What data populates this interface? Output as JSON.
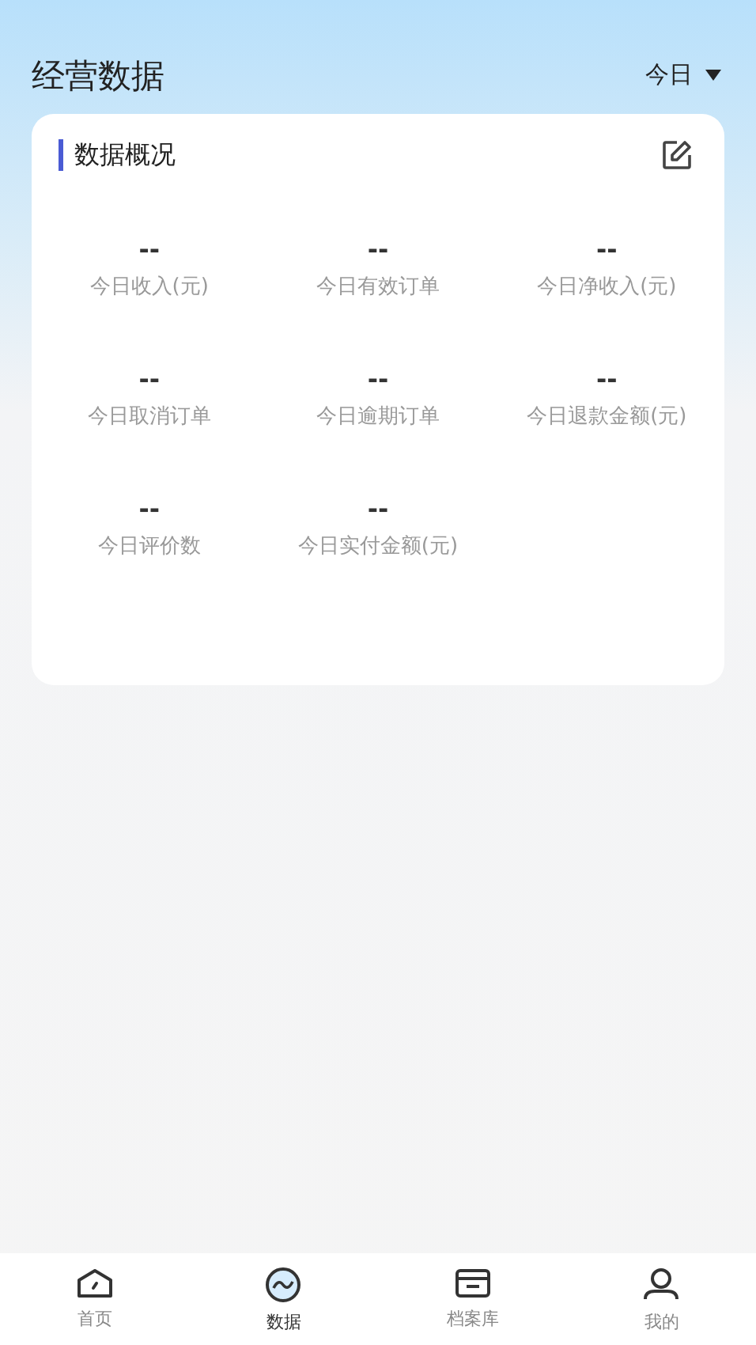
{
  "header": {
    "title": "经营数据",
    "period": "今日"
  },
  "card": {
    "title": "数据概况",
    "metrics": [
      {
        "value": "--",
        "label": "今日收入(元)"
      },
      {
        "value": "--",
        "label": "今日有效订单"
      },
      {
        "value": "--",
        "label": "今日净收入(元)"
      },
      {
        "value": "--",
        "label": "今日取消订单"
      },
      {
        "value": "--",
        "label": "今日逾期订单"
      },
      {
        "value": "--",
        "label": "今日退款金额(元)"
      },
      {
        "value": "--",
        "label": "今日评价数"
      },
      {
        "value": "--",
        "label": "今日实付金额(元)"
      }
    ]
  },
  "tab_bar": [
    {
      "label": "首页",
      "kind": "home",
      "selected": false
    },
    {
      "label": "数据",
      "kind": "data",
      "selected": true
    },
    {
      "label": "档案库",
      "kind": "archive",
      "selected": false
    },
    {
      "label": "我的",
      "kind": "profile",
      "selected": false
    }
  ]
}
